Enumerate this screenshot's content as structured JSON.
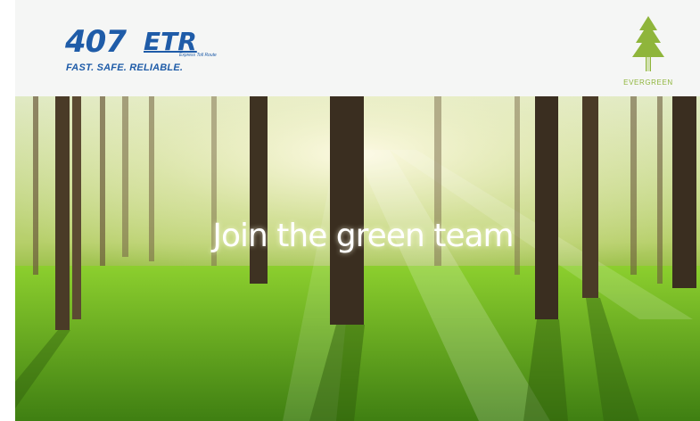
{
  "brand": {
    "logo_number": "407",
    "logo_letters": "ETR",
    "logo_subtext": "Express Toll Route",
    "tagline": "FAST. SAFE. RELIABLE.",
    "badge_icon": "pine-tree-icon",
    "badge_label": "EVERGREEN"
  },
  "hero": {
    "headline": "Join the green team",
    "image": "sunlit-forest-image"
  },
  "colors": {
    "brand_blue": "#1f5ca8",
    "evergreen_green": "#8fb53b",
    "header_bg": "#f5f6f5",
    "moss_green": "#7fbf2a"
  }
}
